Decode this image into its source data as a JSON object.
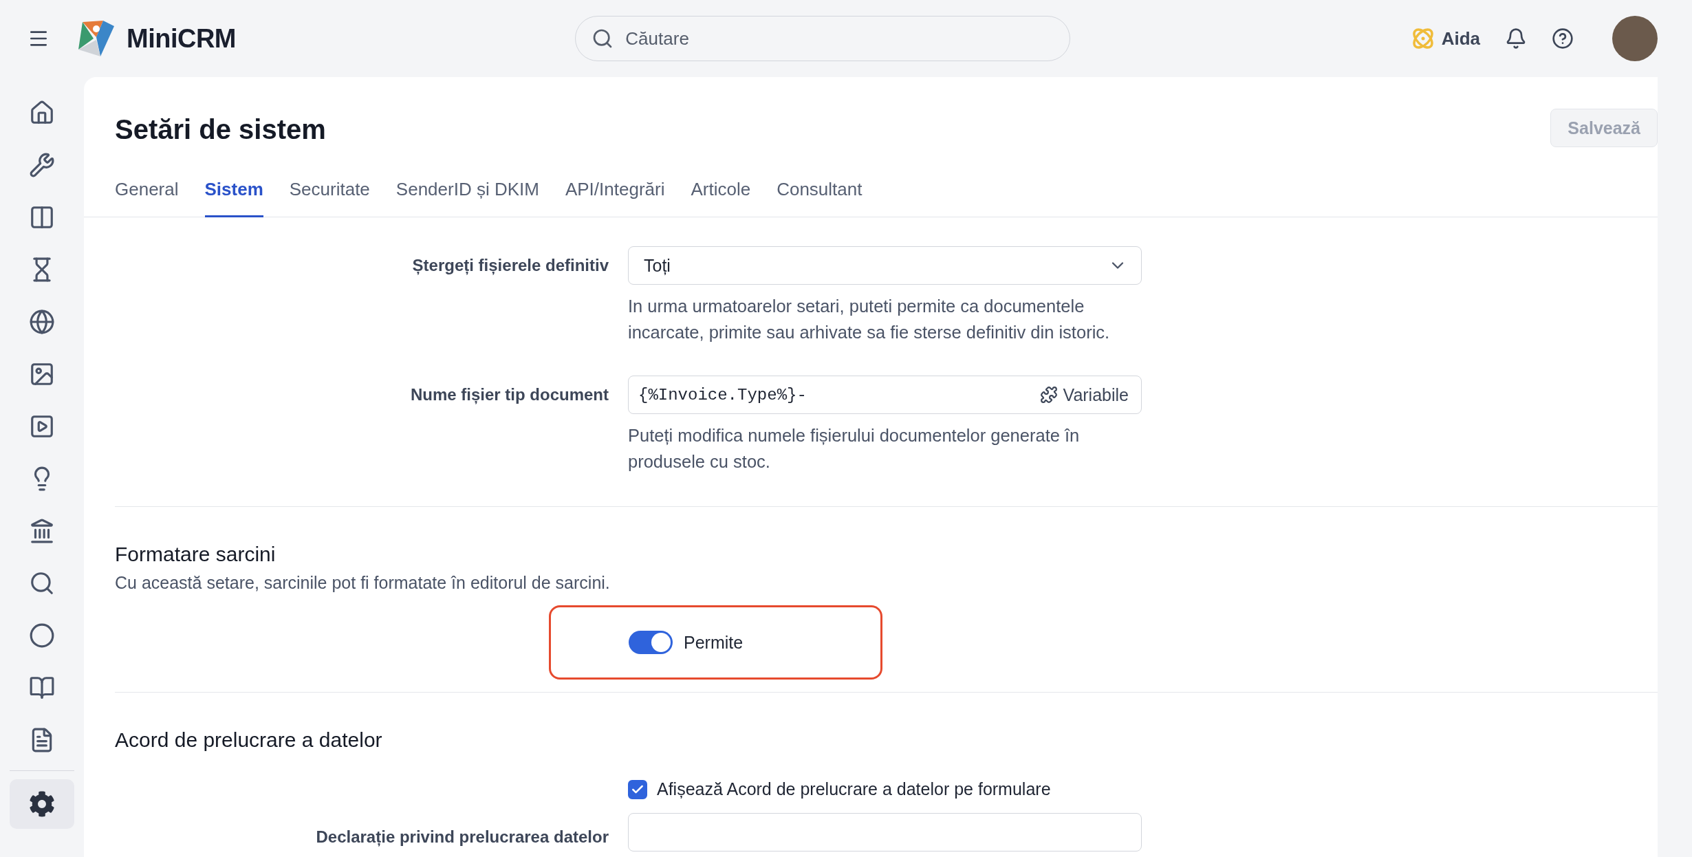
{
  "topbar": {
    "app_name": "MiniCRM",
    "search": {
      "placeholder": "Căutare"
    },
    "assistant": "Aida"
  },
  "sidebar": {
    "items": [
      {
        "selected": false
      },
      {
        "selected": false
      },
      {
        "selected": false
      },
      {
        "selected": false
      },
      {
        "selected": false
      },
      {
        "selected": false
      },
      {
        "selected": false
      },
      {
        "selected": false
      },
      {
        "selected": false
      },
      {
        "selected": false
      },
      {
        "selected": false
      },
      {
        "selected": false
      },
      {
        "selected": false
      },
      {
        "selected": true
      }
    ]
  },
  "page": {
    "title": "Setări de sistem",
    "save_button": {
      "label": "Salvează",
      "disabled": true
    }
  },
  "tabs": [
    {
      "label": "General",
      "selected": false
    },
    {
      "label": "Sistem",
      "selected": true
    },
    {
      "label": "Securitate",
      "selected": false
    },
    {
      "label": "SenderID și DKIM",
      "selected": false
    },
    {
      "label": "API/Integrări",
      "selected": false
    },
    {
      "label": "Articole",
      "selected": false
    },
    {
      "label": "Consultant",
      "selected": false
    }
  ],
  "fields": [
    {
      "kind": "select",
      "label": "Ștergeți fișierele definitiv",
      "value": "Toți",
      "help": "In urma urmatoarelor setari, puteti permite ca documentele incarcate, primite sau arhivate sa fie sterse definitiv din istoric."
    },
    {
      "kind": "template",
      "label": "Nume fișier tip document",
      "value": "{%Invoice.Type%}-",
      "button": "Variabile",
      "help": "Puteți modifica numele fișierului documentelor generate în produsele cu stoc."
    }
  ],
  "sections": [
    {
      "title": "Formatare sarcini",
      "description": "Cu această setare, sarcinile pot fi formatate în editorul de sarcini.",
      "controls": [
        {
          "kind": "toggle",
          "label": "Permite",
          "on": true,
          "highlighted": true
        }
      ]
    },
    {
      "title": "Acord de prelucrare a datelor",
      "controls": [
        {
          "kind": "checkbox",
          "label": "Afișează Acord de prelucrare a datelor pe formulare",
          "checked": true
        },
        {
          "kind": "textfield",
          "label": "Declarație privind prelucrarea datelor"
        }
      ]
    }
  ]
}
